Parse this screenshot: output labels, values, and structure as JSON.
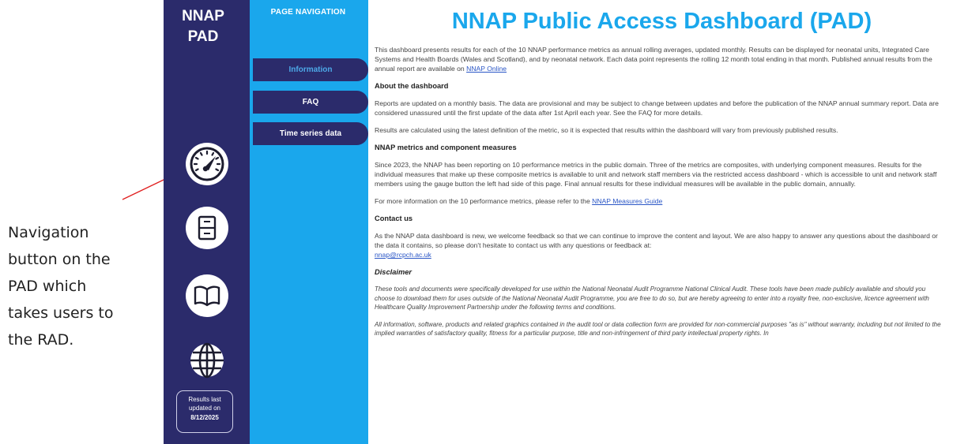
{
  "annotation": {
    "lines": [
      "Navigation",
      "button on the",
      "PAD which",
      "takes users to",
      "the RAD."
    ]
  },
  "rail": {
    "title_line1": "NNAP",
    "title_line2": "PAD",
    "buttons": [
      {
        "name": "gauge-button",
        "icon": "gauge-icon"
      },
      {
        "name": "cabinet-button",
        "icon": "filing-cabinet-icon"
      },
      {
        "name": "book-button",
        "icon": "book-icon"
      },
      {
        "name": "globe-button",
        "icon": "globe-icon"
      }
    ],
    "results": {
      "line1": "Results last",
      "line2": "updated on",
      "date": "8/12/2025"
    }
  },
  "page_nav": {
    "title": "PAGE NAVIGATION",
    "items": [
      {
        "label": "Information",
        "active": true
      },
      {
        "label": "FAQ",
        "active": false
      },
      {
        "label": "Time series data",
        "active": false
      }
    ]
  },
  "main": {
    "title": "NNAP Public Access Dashboard (PAD)",
    "intro": "This dashboard presents results for each of the 10 NNAP performance metrics as annual rolling averages, updated monthly. Results can be displayed for neonatal units, Integrated Care Systems and Health Boards (Wales and Scotland), and by neonatal network. Each data point represents the rolling 12 month total ending in that month. Published annual results from the annual report are available on",
    "intro_link": "NNAP Online",
    "about_heading": "About the dashboard",
    "about_p1": "Reports are updated on a monthly basis. The data are provisional and may be subject to change between updates and before the publication of the NNAP annual summary report. Data are considered unassured until the first update of the data after 1st April each year. See the FAQ for more details.",
    "about_p2": "Results are calculated using the latest definition of the metric, so it is expected that results within the dashboard will vary from previously published results.",
    "metrics_heading": "NNAP metrics and component measures",
    "metrics_p1": "Since 2023, the NNAP has been reporting on 10 performance metrics in the public domain. Three of the metrics are composites, with underlying component measures. Results for the individual measures that make up these composite metrics is available to unit and network staff members via the restricted access dashboard - which is accessible to unit and network staff members using the gauge button the left had side of this page. Final annual results for these individual measures will be available in the public domain, annually.",
    "metrics_p2": "For more information on the 10 performance metrics, please refer to the",
    "metrics_link": "NNAP Measures Guide",
    "contact_heading": "Contact us",
    "contact_p": "As the NNAP data dashboard is new, we welcome feedback so that we can continue to improve the content and layout. We are also happy to answer any questions about the dashboard or the data it contains, so please don't hesitate to contact us with any questions or feedback at:",
    "contact_link": "nnap@rcpch.ac.uk",
    "disclaimer_heading": "Disclaimer",
    "disclaimer_p1": "These tools and documents were specifically developed for use within the National Neonatal Audit Programme National Clinical Audit. These tools have been made publicly available and should you choose to download them for uses outside of the National Neonatal Audit Programme, you are free to do so, but are hereby agreeing to enter into a royalty free, non-exclusive, licence agreement with Healthcare Quality Improvement Partnership under the following terms and conditions.",
    "disclaimer_p2": "All information, software, products and related graphics contained in the audit tool or data collection form are provided for non-commercial purposes \"as is\" without warranty, including but not limited to the implied warranties of satisfactory quality, fitness for a particular purpose, title and non-infringement of third party intellectual property rights. In"
  },
  "colors": {
    "rail": "#2b2b6b",
    "nav": "#1aa7ec",
    "title": "#1aa7ec",
    "arrow": "#e02020"
  }
}
